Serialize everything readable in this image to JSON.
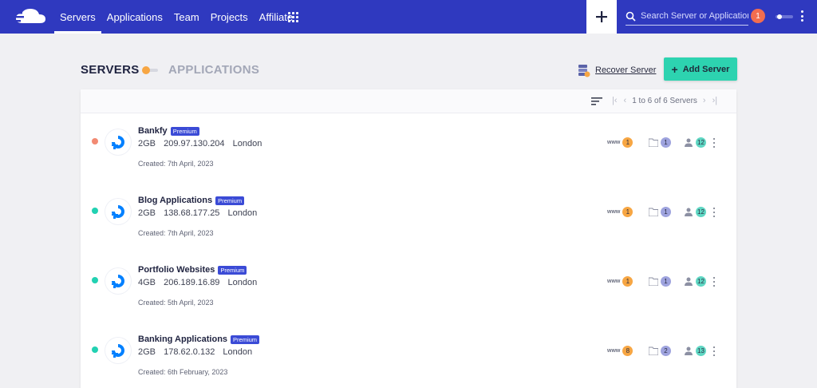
{
  "nav": {
    "items": [
      {
        "label": "Servers",
        "active": true
      },
      {
        "label": "Applications",
        "active": false
      },
      {
        "label": "Team",
        "active": false
      },
      {
        "label": "Projects",
        "active": false
      },
      {
        "label": "Affiliate",
        "active": false
      }
    ],
    "search_placeholder": "Search Server or Application",
    "notification_count": "1"
  },
  "header": {
    "tab_servers": "SERVERS",
    "tab_applications": "APPLICATIONS",
    "recover_label": "Recover Server",
    "add_label": "Add Server"
  },
  "pager": {
    "text": "1 to 6 of 6 Servers"
  },
  "servers": [
    {
      "name": "Bankfy",
      "badge": "Premium",
      "size": "2GB",
      "ip": "209.97.130.204",
      "location": "London",
      "created": "Created: 7th April, 2023",
      "status_color": "#f28a73",
      "www": "1",
      "files": "1",
      "users": "12"
    },
    {
      "name": "Blog Applications",
      "badge": "Premium",
      "size": "2GB",
      "ip": "138.68.177.25",
      "location": "London",
      "created": "Created: 7th April, 2023",
      "status_color": "#22d1b2",
      "www": "1",
      "files": "1",
      "users": "12"
    },
    {
      "name": "Portfolio Websites",
      "badge": "Premium",
      "size": "4GB",
      "ip": "206.189.16.89",
      "location": "London",
      "created": "Created: 5th April, 2023",
      "status_color": "#22d1b2",
      "www": "1",
      "files": "1",
      "users": "12"
    },
    {
      "name": "Banking Applications",
      "badge": "Premium",
      "size": "2GB",
      "ip": "178.62.0.132",
      "location": "London",
      "created": "Created: 6th February, 2023",
      "status_color": "#22d1b2",
      "www": "8",
      "files": "2",
      "users": "13"
    }
  ],
  "icons": {
    "logo": "cloud-logo-icon",
    "grid": "apps-grid-icon",
    "plus": "plus-icon",
    "search": "search-icon",
    "server_provider": "digitalocean-icon",
    "www": "www-icon",
    "folder": "folder-icon",
    "user": "user-icon"
  },
  "colors": {
    "brand": "#2f39bf",
    "accent": "#2dd3b0",
    "badge": "#3b4bd6"
  }
}
